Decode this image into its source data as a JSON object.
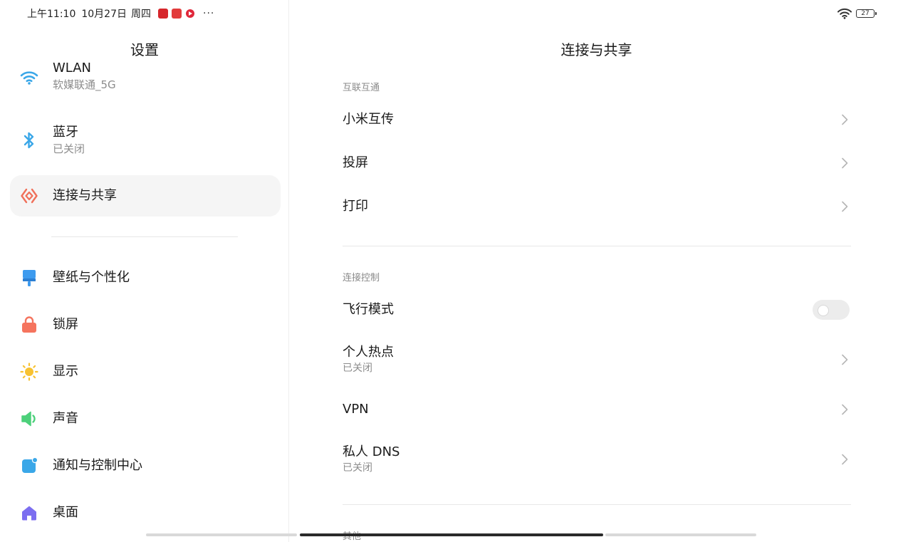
{
  "status_bar": {
    "time": "上午11:10",
    "date": "10月27日",
    "weekday": "周四",
    "more": "···",
    "battery": "27"
  },
  "sidebar": {
    "title": "设置",
    "items": [
      {
        "label": "WLAN",
        "sub": "软媒联通_5G",
        "icon": "wifi-icon",
        "color": "#3aa7e8"
      },
      {
        "label": "蓝牙",
        "sub": "已关闭",
        "icon": "bluetooth-icon",
        "color": "#3aa7e8"
      },
      {
        "label": "连接与共享",
        "icon": "connection-share-icon",
        "color": "#f0705a",
        "active": true
      },
      {
        "label": "壁纸与个性化",
        "icon": "wallpaper-brush-icon",
        "color": "#3d9bef"
      },
      {
        "label": "锁屏",
        "icon": "lock-icon",
        "color": "#f5745e"
      },
      {
        "label": "显示",
        "icon": "sun-icon",
        "color": "#f7c232"
      },
      {
        "label": "声音",
        "icon": "speaker-icon",
        "color": "#4cd07a"
      },
      {
        "label": "通知与控制中心",
        "icon": "notification-icon",
        "color": "#3aa7e8"
      },
      {
        "label": "桌面",
        "icon": "home-icon",
        "color": "#7c6ef0"
      }
    ]
  },
  "main": {
    "title": "连接与共享",
    "sections": [
      {
        "label": "互联互通",
        "rows": [
          {
            "label": "小米互传"
          },
          {
            "label": "投屏"
          },
          {
            "label": "打印"
          }
        ]
      },
      {
        "label": "连接控制",
        "rows": [
          {
            "label": "飞行模式",
            "toggle": false
          },
          {
            "label": "个人热点",
            "sub": "已关闭"
          },
          {
            "label": "VPN"
          },
          {
            "label": "私人 DNS",
            "sub": "已关闭"
          }
        ]
      },
      {
        "label": "其他"
      }
    ]
  }
}
